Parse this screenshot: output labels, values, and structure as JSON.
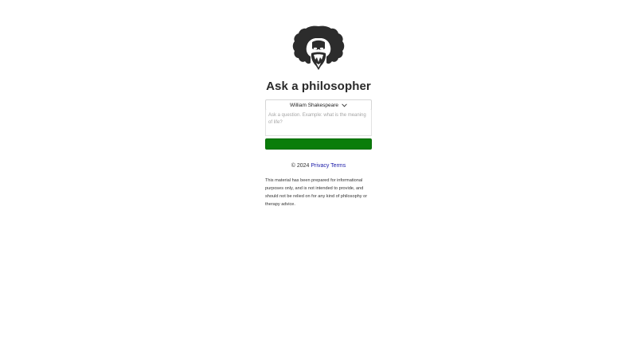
{
  "header": {
    "title": "Ask a philosopher"
  },
  "form": {
    "selected_philosopher": "William Shakespeare",
    "question_placeholder": "Ask a question. Example: what is the meaning of life?",
    "question_value": "",
    "submit_label": ""
  },
  "footer": {
    "copyright": "© 2024",
    "privacy_label": "Privacy",
    "terms_label": "Terms",
    "disclaimer": "This material has been prepared for informational purposes only, and is not intended to provide, and should not be relied on for any kind of philosophy or therapy advice."
  },
  "icons": {
    "logo": "philosopher-portrait-icon",
    "dropdown": "chevron-down-icon"
  },
  "colors": {
    "button": "#0a7d0a",
    "link": "#1a1aa8",
    "logo": "#2c2c2c"
  }
}
